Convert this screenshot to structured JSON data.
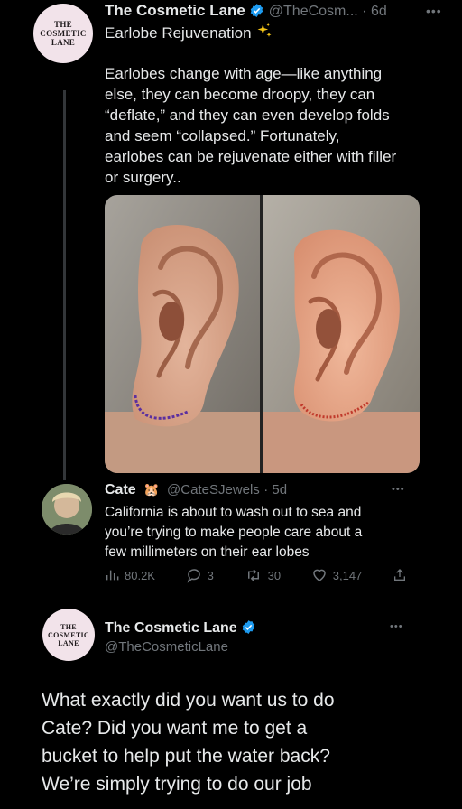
{
  "tweet1": {
    "avatar_text": [
      "THE",
      "COSMETIC",
      "LANE"
    ],
    "name": "The Cosmetic Lane",
    "handle": "@TheCosm...",
    "time": "· 6d",
    "title": "Earlobe Rejuvenation",
    "title_emoji": "sparkles-icon",
    "body": "Earlobes change with age—like anything else, they can become droopy, they can “deflate,” and they can even develop folds and seem “collapsed.” Fortunately, earlobes can be rejuvenate either with filler or surgery..",
    "body_lines": [
      "Earlobes change with age—like anything",
      "else, they can become droopy, they can",
      "“deflate,” and they can even develop folds",
      "and seem “collapsed.” Fortunately,",
      "earlobes can be rejuvenate either with filler",
      "or surgery.."
    ]
  },
  "tweet2": {
    "name": "Cate",
    "emoji": "hamster-icon",
    "handle": "@CateSJewels",
    "time": "· 5d",
    "body_lines": [
      "California is about to wash out to sea and",
      "you’re trying to make people care about a",
      "few millimeters on their ear lobes"
    ],
    "stats": {
      "views": "80.2K",
      "replies": "3",
      "retweets": "30",
      "likes": "3,147"
    }
  },
  "tweet3": {
    "avatar_text": [
      "THE",
      "COSMETIC",
      "LANE"
    ],
    "name": "The Cosmetic Lane",
    "handle": "@TheCosmeticLane",
    "body_lines": [
      "What exactly did you want us to do",
      "Cate? Did you want me to get a",
      "bucket to help put the water back?",
      "We’re simply trying to do our job"
    ]
  },
  "colors": {
    "background": "#000000",
    "text": "#e7e9ea",
    "muted": "#71767b",
    "verified": "#1d9bf0",
    "avatar_bg": "#f2e3ea"
  }
}
